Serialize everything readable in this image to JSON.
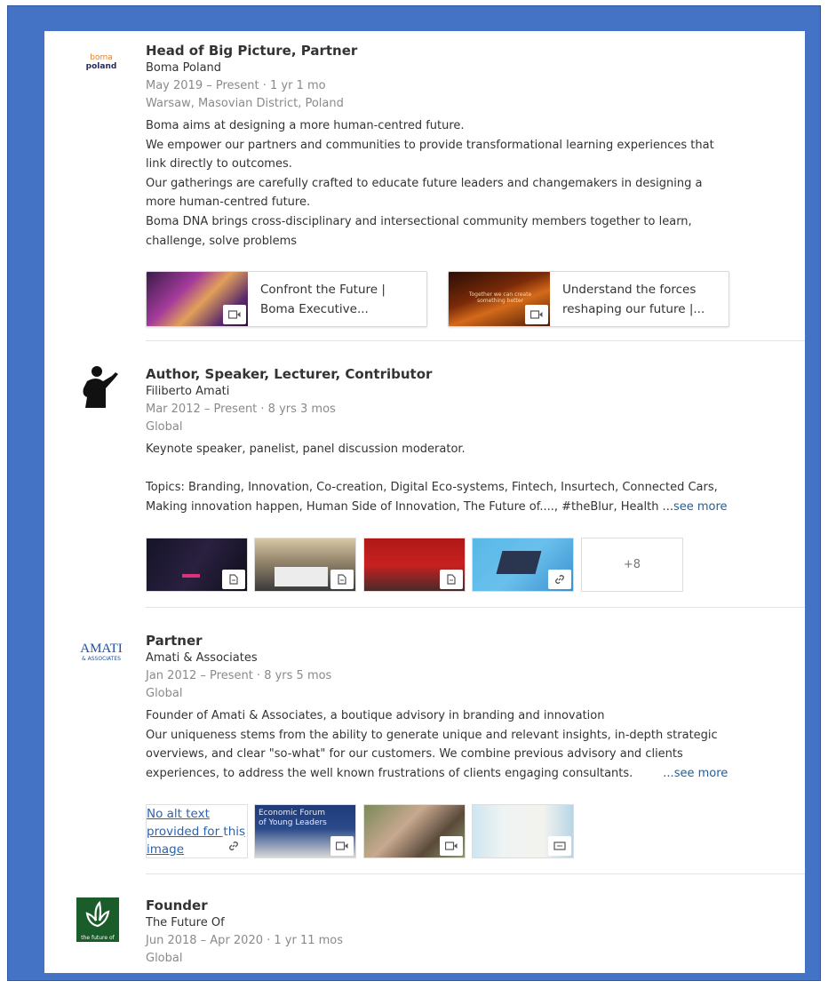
{
  "positions": [
    {
      "title": "Head of Big Picture, Partner",
      "company": "Boma Poland",
      "dates": "May 2019 – Present · 1 yr 1 mo",
      "location": "Warsaw, Masovian District, Poland",
      "logo": {
        "line1": "boma",
        "line2": "poland",
        "color": "#e8822e"
      },
      "description": [
        "Boma aims at designing a more human-centred future.",
        "We empower our partners and communities to provide transformational learning experiences that",
        "link directly to outcomes.",
        "Our gatherings are carefully crafted to educate future leaders and changemakers in designing a",
        "more human-centred future.",
        "Boma DNA brings cross-disciplinary and intersectional community members together to learn,",
        "challenge, solve problems"
      ],
      "media_links": [
        {
          "label_line1": "Confront the Future |",
          "label_line2": "Boma Executive...",
          "icon": "video-icon"
        },
        {
          "label_line1": "Understand the forces",
          "label_line2": "reshaping our future |...",
          "thumb_text_1": "Together we can create",
          "thumb_text_2": "something better",
          "icon": "video-icon"
        }
      ]
    },
    {
      "title": "Author, Speaker, Lecturer, Contributor",
      "company": "Filiberto Amati",
      "dates": "Mar 2012 – Present · 8 yrs 3 mos",
      "location": "Global",
      "logo": {
        "icon": "speaker-silhouette-icon"
      },
      "description_1": "Keynote speaker, panelist, panel discussion moderator.",
      "description_2": "Topics: Branding, Innovation, Co-creation, Digital Eco-systems, Fintech, Insurtech, Connected Cars,",
      "description_3": "Making innovation happen, Human Side of Innovation, The Future of...., #theBlur, Health ...",
      "see_more": "see more",
      "media_tiles": [
        {
          "icon": "document-icon"
        },
        {
          "icon": "document-icon"
        },
        {
          "icon": "document-icon"
        },
        {
          "icon": "link-icon"
        }
      ],
      "more_count": "+8"
    },
    {
      "title": "Partner",
      "company": "Amati & Associates",
      "dates": "Jan 2012 – Present · 8 yrs 5 mos",
      "location": "Global",
      "logo": {
        "line1": "AMATI",
        "line2": "& ASSOCIATES",
        "color": "#1d4f9c"
      },
      "description": [
        "Founder of Amati & Associates, a boutique advisory in branding and innovation",
        "Our uniqueness stems from the ability to generate unique and relevant insights, in-depth strategic",
        "overviews, and clear \"so-what\" for our customers. We combine previous advisory and clients"
      ],
      "description_last": "experiences, to address the well known frustrations of clients engaging consultants.",
      "see_more": "...see more",
      "media_tiles": [
        {
          "alt_line1": "No alt text",
          "alt_line2": "provided for this",
          "alt_line3": "image",
          "icon": "link-icon"
        },
        {
          "thumb_text_1": "Economic Forum",
          "thumb_text_2": "of Young Leaders",
          "icon": "video-icon"
        },
        {
          "icon": "video-icon"
        },
        {
          "icon": "presentation-icon"
        }
      ]
    },
    {
      "title": "Founder",
      "company": "The Future Of",
      "dates": "Jun 2018 – Apr 2020 · 1 yr 11 mos",
      "location": "Global",
      "logo": {
        "caption": "the future of",
        "color": "#1a5c2a"
      }
    }
  ]
}
